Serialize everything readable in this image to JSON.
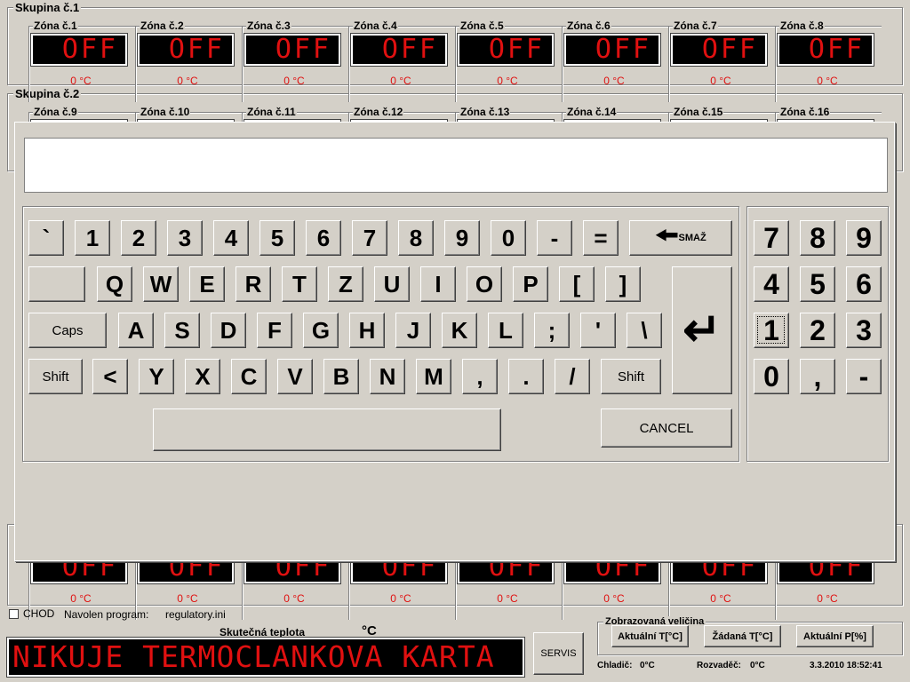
{
  "groups": [
    {
      "title": "Skupina č.1",
      "zones": [
        "Zóna č.1",
        "Zóna č.2",
        "Zóna č.3",
        "Zóna č.4",
        "Zóna č.5",
        "Zóna č.6",
        "Zóna č.7",
        "Zóna č.8"
      ]
    },
    {
      "title": "Skupina č.2",
      "zones": [
        "Zóna č.9",
        "Zóna č.10",
        "Zóna č.11",
        "Zóna č.12",
        "Zóna č.13",
        "Zóna č.14",
        "Zóna č.15",
        "Zóna č.16"
      ]
    }
  ],
  "zone_display": "OFF",
  "zone_temp": "0 °C",
  "keyboard": {
    "input_value": "",
    "row1": [
      "`",
      "1",
      "2",
      "3",
      "4",
      "5",
      "6",
      "7",
      "8",
      "9",
      "0",
      "-",
      "="
    ],
    "backspace_label": "SMAŽ",
    "row2": [
      "",
      "Q",
      "W",
      "E",
      "R",
      "T",
      "Z",
      "U",
      "I",
      "O",
      "P",
      "[",
      "]"
    ],
    "caps_label": "Caps",
    "row3": [
      "A",
      "S",
      "D",
      "F",
      "G",
      "H",
      "J",
      "K",
      "L",
      ";",
      "'",
      "\\"
    ],
    "shift_label": "Shift",
    "row4": [
      "<",
      "Y",
      "X",
      "C",
      "V",
      "B",
      "N",
      "M",
      ",",
      ".",
      "/"
    ],
    "cancel_label": "CANCEL",
    "numpad": [
      "7",
      "8",
      "9",
      "4",
      "5",
      "6",
      "1",
      "2",
      "3",
      "0",
      ",",
      "-"
    ]
  },
  "bottom": {
    "chod_label": "CHOD",
    "program_label": "Navolen program:",
    "program_value": "regulatory.ini",
    "actual_temp_label": "Skutečná teplota",
    "unit": "°C",
    "main_display": "NIKUJE TERMOCLANKOVA KARTA",
    "servis_label": "SERVIS",
    "quantity_group_title": "Zobrazovaná veličina",
    "quantity_buttons": [
      "Aktuální T[°C]",
      "Žádaná T[°C]",
      "Aktuální P[%]"
    ],
    "chladic_label": "Chladič:",
    "chladic_value": "0°C",
    "rozvadec_label": "Rozvaděč:",
    "rozvadec_value": "0°C",
    "datetime": "3.3.2010 18:52:41"
  },
  "colors": {
    "led_text": "#e01010",
    "led_bg": "#000000",
    "window_bg": "#d4d0c8"
  }
}
